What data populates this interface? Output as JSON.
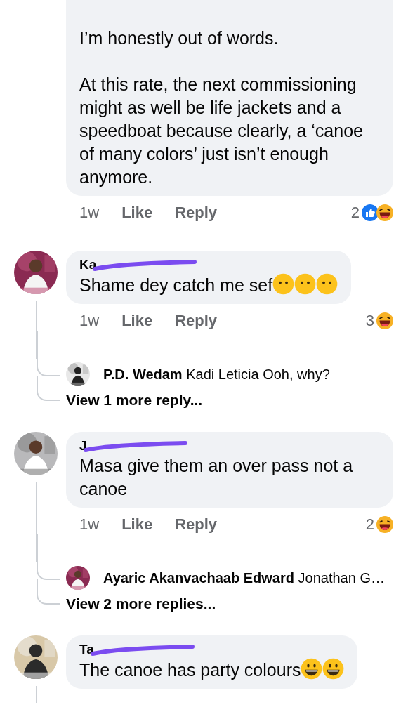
{
  "comments": [
    {
      "paragraphs": [
        "I’m honestly out of words.",
        "At this rate, the next commissioning might as well be life jackets and a speedboat because clearly, a ‘canoe of many colors’ just isn’t enough anymore."
      ],
      "time": "1w",
      "like": "Like",
      "reply": "Reply",
      "reaction_count": "2",
      "reactions": [
        {
          "kind": "like"
        },
        {
          "kind": "haha"
        }
      ]
    },
    {
      "name": "Ka",
      "paragraphs": [
        "Shame dey catch me sef"
      ],
      "emojis": [
        {
          "kind": "no-mouth"
        },
        {
          "kind": "no-mouth"
        },
        {
          "kind": "no-mouth"
        }
      ],
      "time": "1w",
      "like": "Like",
      "reply": "Reply",
      "reaction_count": "3",
      "reactions": [
        {
          "kind": "haha"
        }
      ],
      "thread": true,
      "replies": [
        {
          "name": "P.D. Wedam",
          "text": "Kadi Leticia Ooh, why?"
        }
      ],
      "more": "View 1 more reply..."
    },
    {
      "name": "J",
      "paragraphs": [
        "Masa give them an over pass not a canoe"
      ],
      "time": "1w",
      "like": "Like",
      "reply": "Reply",
      "reaction_count": "2",
      "reactions": [
        {
          "kind": "haha"
        }
      ],
      "thread": true,
      "replies": [
        {
          "name": "Ayaric Akanvachaab Edward",
          "text": "Jonathan G…"
        }
      ],
      "more": "View 2 more replies..."
    },
    {
      "name": "Ta",
      "paragraphs": [
        "The canoe has party colours"
      ],
      "emojis": [
        {
          "kind": "grin"
        },
        {
          "kind": "grin"
        }
      ],
      "thread": true
    }
  ]
}
